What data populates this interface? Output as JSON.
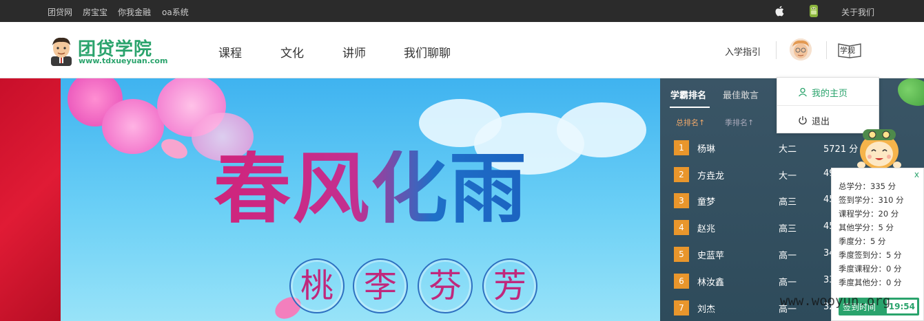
{
  "topbar": {
    "links": [
      "团贷网",
      "房宝宝",
      "你我金融",
      "oa系统"
    ],
    "apple_icon": "apple-icon",
    "android_icon": "android-icon",
    "about": "关于我们"
  },
  "header": {
    "logo_title": "团贷学院",
    "logo_url": "www.tdxueyuan.com",
    "nav": [
      "课程",
      "文化",
      "讲师",
      "我们聊聊"
    ],
    "guide": "入学指引",
    "rules_label": "学规"
  },
  "banner": {
    "title": "春风化雨",
    "circle_chars": [
      "桃",
      "李",
      "芬",
      "芳"
    ]
  },
  "ranking": {
    "tabs": [
      "学霸排名",
      "最佳敢言"
    ],
    "subtabs": [
      "总排名",
      "季排名"
    ],
    "sort_arrow": "↑",
    "rows": [
      {
        "rank": "1",
        "name": "杨琳",
        "grade": "大二",
        "score": "5721 分"
      },
      {
        "rank": "2",
        "name": "方垚龙",
        "grade": "大一",
        "score": "49"
      },
      {
        "rank": "3",
        "name": "童梦",
        "grade": "高三",
        "score": "45"
      },
      {
        "rank": "4",
        "name": "赵兆",
        "grade": "高三",
        "score": "45"
      },
      {
        "rank": "5",
        "name": "史蓝苹",
        "grade": "高一",
        "score": "34"
      },
      {
        "rank": "6",
        "name": "林汝鑫",
        "grade": "高一",
        "score": "33"
      },
      {
        "rank": "7",
        "name": "刘杰",
        "grade": "高一",
        "score": "32"
      }
    ]
  },
  "dropdown": {
    "home": "我的主页",
    "logout": "退出"
  },
  "score_card": {
    "close": "x",
    "lines": [
      "总学分：335 分",
      "签到学分：310 分",
      "课程学分：20 分",
      "其他学分：5 分",
      "季度分：5 分",
      "季度签到分：5 分",
      "季度课程分：0 分",
      "季度其他分：0 分"
    ],
    "checkin_label": "签到时间",
    "checkin_time": "19:54"
  },
  "watermark": "www.wooyun.org",
  "colors": {
    "brand_green": "#2aa36c",
    "rank_badge": "#e9962c",
    "topbar": "#2b2b2b"
  }
}
